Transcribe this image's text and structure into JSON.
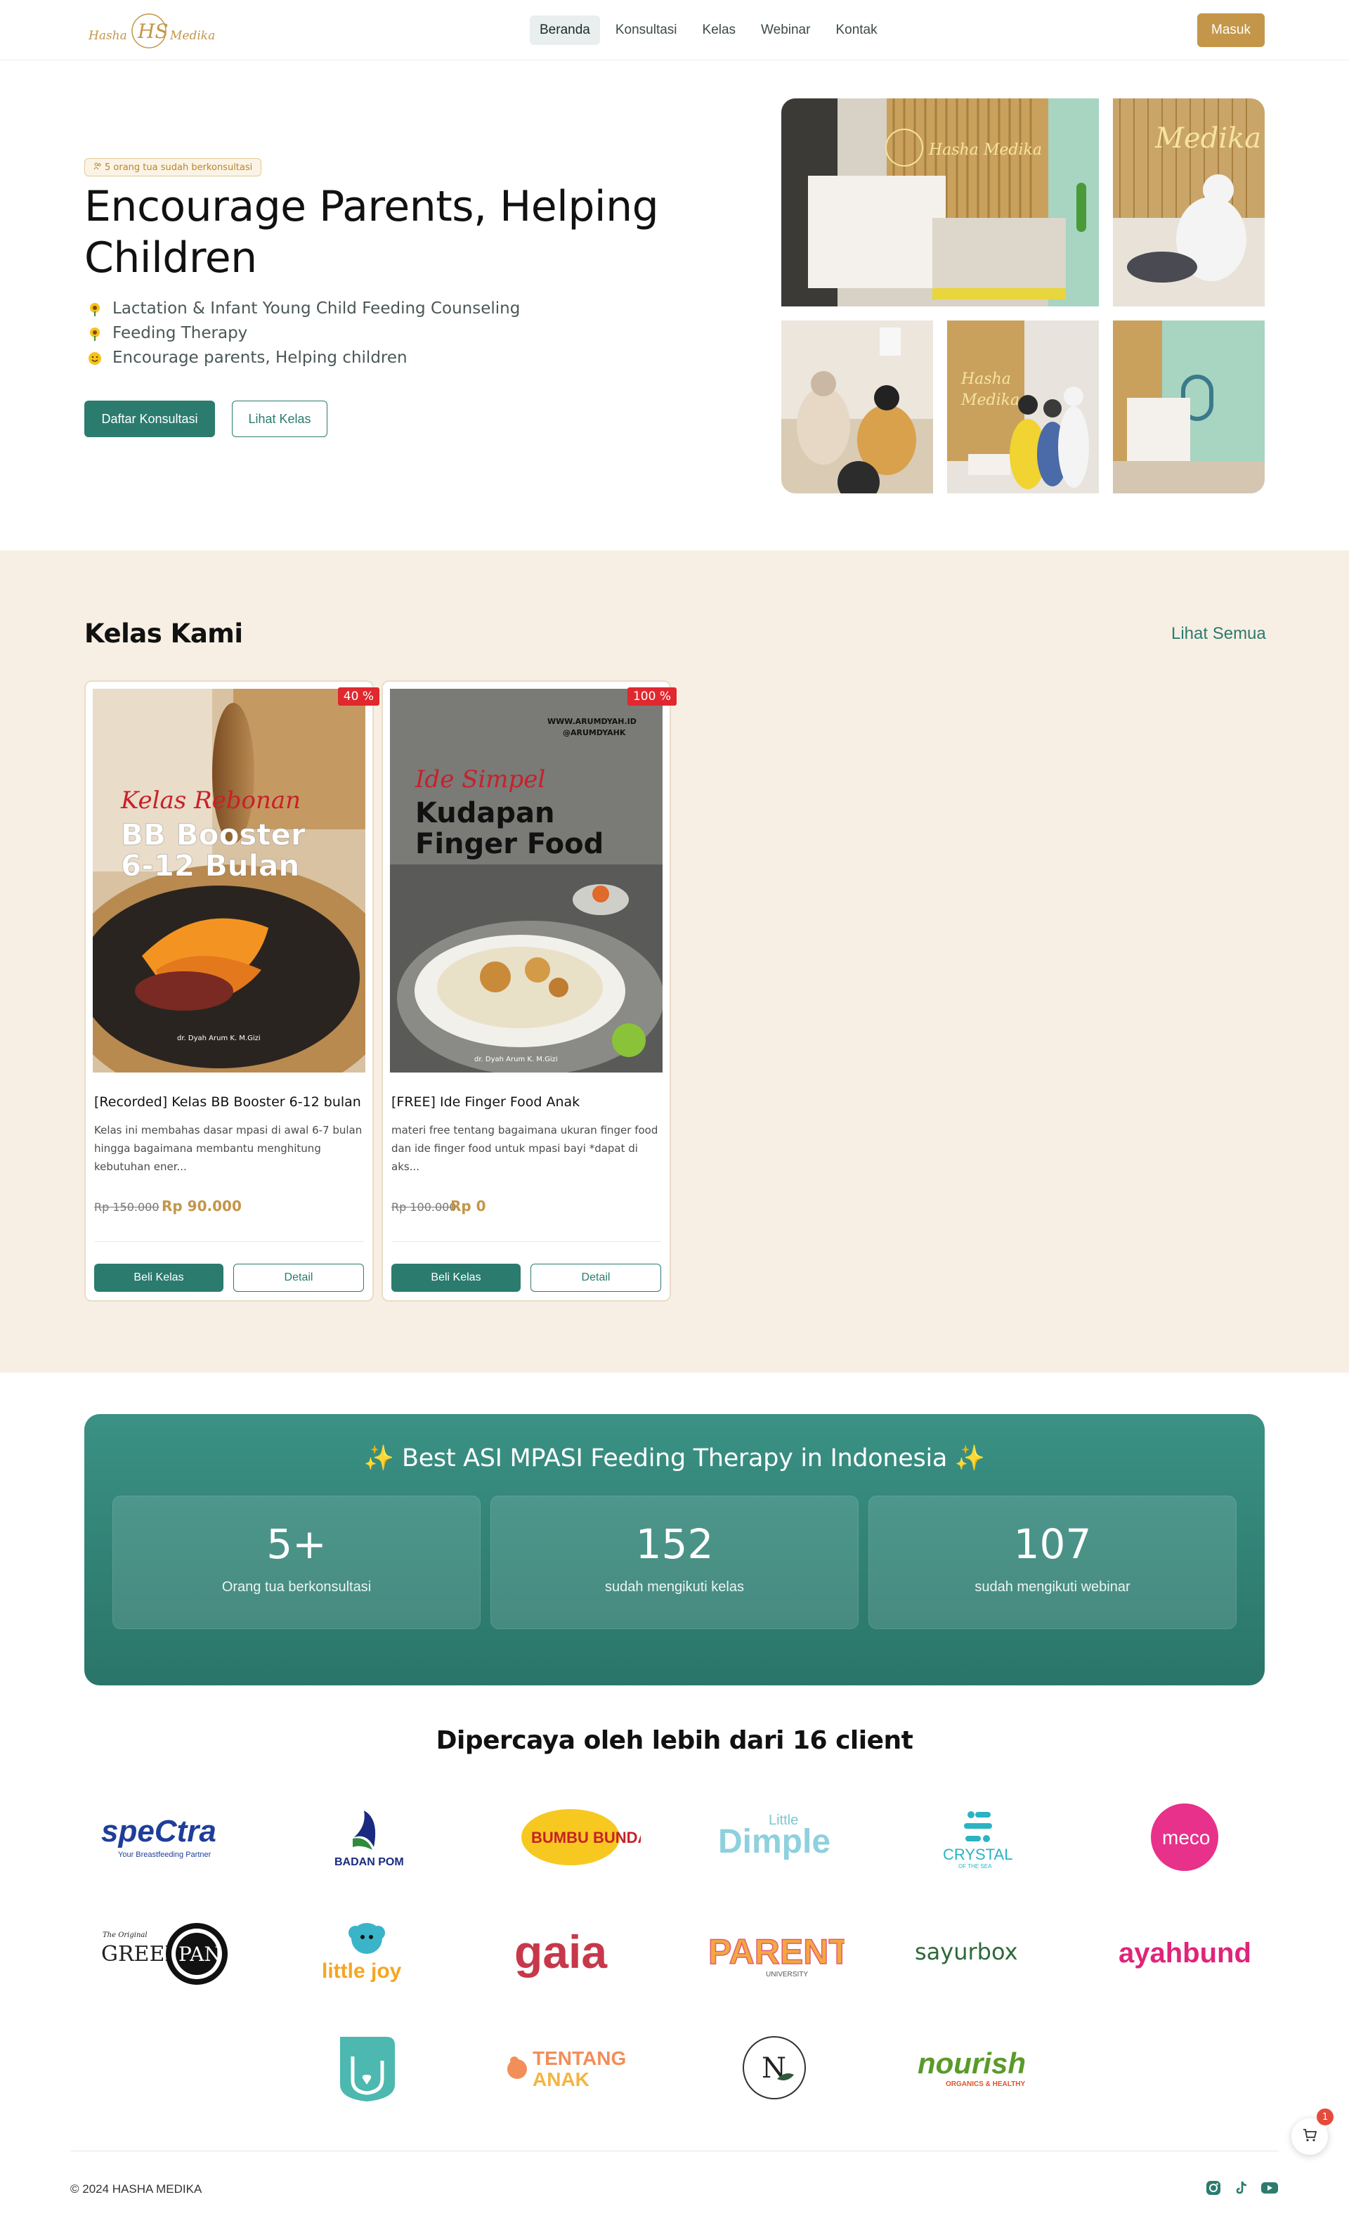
{
  "nav": {
    "logo_text_left": "Hasha",
    "logo_text_right": "Medika",
    "logo_monogram": "HS",
    "links": [
      "Beranda",
      "Konsultasi",
      "Kelas",
      "Webinar",
      "Kontak"
    ],
    "active": "Beranda",
    "login": "Masuk"
  },
  "hero": {
    "badge": "5 orang tua sudah berkonsultasi",
    "title": "Encourage Parents, Helping Children",
    "bullets": [
      {
        "icon": "sunflower-icon",
        "text": "Lactation & Infant Young Child Feeding Counseling"
      },
      {
        "icon": "sunflower-icon",
        "text": "Feeding Therapy"
      },
      {
        "icon": "smiley-icon",
        "text": "Encourage parents, Helping children"
      }
    ],
    "cta_primary": "Daftar Konsultasi",
    "cta_secondary": "Lihat Kelas",
    "gallery_sign": "Hasha Medika"
  },
  "classes": {
    "title": "Kelas Kami",
    "see_all": "Lihat Semua",
    "cards": [
      {
        "discount": "40 %",
        "image_script": "Kelas Rebonan",
        "image_title_1": "BB Booster",
        "image_title_2": "6-12 Bulan",
        "image_credit": "dr. Dyah Arum K. M.Gizi",
        "title": "[Recorded] Kelas BB Booster 6-12 bulan",
        "desc": "Kelas ini membahas dasar mpasi di awal 6-7 bulan hingga bagaimana membantu menghitung kebutuhan ener...",
        "old_price": "Rp 150.000",
        "price": "Rp 90.000",
        "buy": "Beli Kelas",
        "detail": "Detail"
      },
      {
        "discount": "100 %",
        "image_site": "WWW.ARUMDYAH.ID",
        "image_handle": "@ARUMDYAHK",
        "image_script": "Ide Simpel",
        "image_title_1": "Kudapan",
        "image_title_2": "Finger Food",
        "image_credit": "dr. Dyah Arum K. M.Gizi",
        "title": "[FREE] Ide Finger Food Anak",
        "desc": "materi free tentang bagaimana ukuran finger food dan ide finger food untuk mpasi bayi *dapat di aks...",
        "old_price": "Rp 100.000",
        "price": "Rp 0",
        "buy": "Beli Kelas",
        "detail": "Detail"
      }
    ]
  },
  "stats": {
    "title": "✨ Best ASI MPASI Feeding Therapy in Indonesia ✨",
    "items": [
      {
        "value": "5+",
        "label": "Orang tua berkonsultasi"
      },
      {
        "value": "152",
        "label": "sudah mengikuti kelas"
      },
      {
        "value": "107",
        "label": "sudah mengikuti webinar"
      }
    ]
  },
  "clients": {
    "title": "Dipercaya oleh lebih dari 16 client",
    "logos": [
      {
        "name": "spectra-logo",
        "text": "speCtra",
        "sub": "Your Breastfeeding Partner"
      },
      {
        "name": "badan-pom-logo",
        "text": "BADAN POM"
      },
      {
        "name": "bumbu-bunda-logo",
        "text": "BUMBU BUNDA"
      },
      {
        "name": "little-dimple-logo",
        "text": "Dimple",
        "sub": "Little"
      },
      {
        "name": "crystal-of-the-sea-logo",
        "text": "CRYSTAL",
        "sub": "OF THE SEA"
      },
      {
        "name": "meco-logo",
        "text": "meco"
      },
      {
        "name": "greenpan-logo",
        "text": "GREEN",
        "sub": "PAN",
        "note": "The Original"
      },
      {
        "name": "little-joy-logo",
        "text": "little joy"
      },
      {
        "name": "gaia-logo",
        "text": "gaia"
      },
      {
        "name": "parent-university-logo",
        "text": "PARENT",
        "sub": "UNIVERSITY"
      },
      {
        "name": "sayurbox-logo",
        "text": "sayurbox"
      },
      {
        "name": "ayahbunda-logo",
        "text": "ayahbunda"
      },
      {
        "name": "hand-logo",
        "text": ""
      },
      {
        "name": "tentang-anak-logo",
        "text": "TENTANG",
        "sub": "ANAK"
      },
      {
        "name": "n-circle-logo",
        "text": "N"
      },
      {
        "name": "nourish-logo",
        "text": "nourish",
        "sub": "ORGANICS & HEALTHY"
      }
    ]
  },
  "footer": {
    "copyright": "© 2024 HASHA MEDIKA",
    "cart_count": "1"
  },
  "colors": {
    "primary": "#2b7b6f",
    "gold": "#c3964a",
    "cream": "#f8efe4",
    "discount": "#e0282e"
  }
}
